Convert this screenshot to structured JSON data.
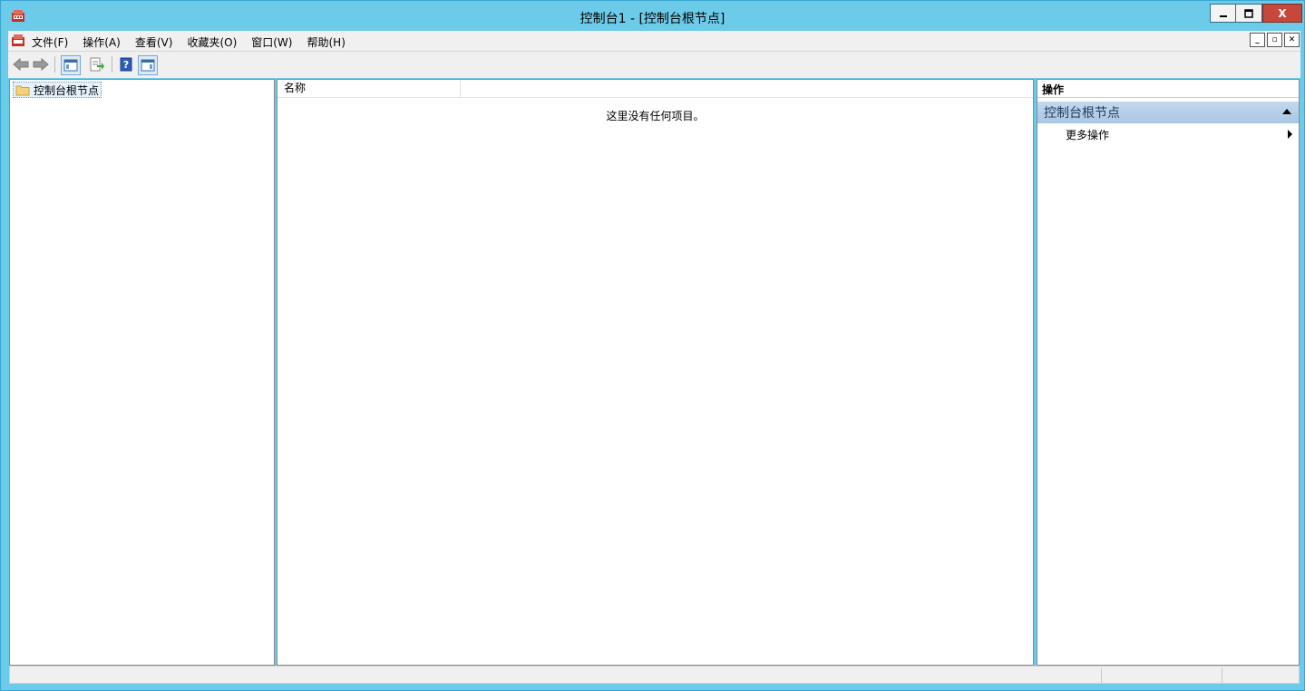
{
  "window": {
    "title": "控制台1 - [控制台根节点]",
    "min_label": "▁",
    "max_label": "□",
    "close_label": "X"
  },
  "menu": {
    "items": [
      {
        "label": "文件(F)"
      },
      {
        "label": "操作(A)"
      },
      {
        "label": "查看(V)"
      },
      {
        "label": "收藏夹(O)"
      },
      {
        "label": "窗口(W)"
      },
      {
        "label": "帮助(H)"
      }
    ],
    "mdi_min": "_",
    "mdi_restore": "▫",
    "mdi_close": "✕"
  },
  "tree": {
    "root_label": "控制台根节点"
  },
  "list": {
    "column_name": "名称",
    "empty_message": "这里没有任何项目。"
  },
  "actions": {
    "header": "操作",
    "group_title": "控制台根节点",
    "more_actions": "更多操作"
  },
  "colors": {
    "frame": "#6ccbe9",
    "close": "#c7483b",
    "group_bg": "#b6cfe9"
  }
}
